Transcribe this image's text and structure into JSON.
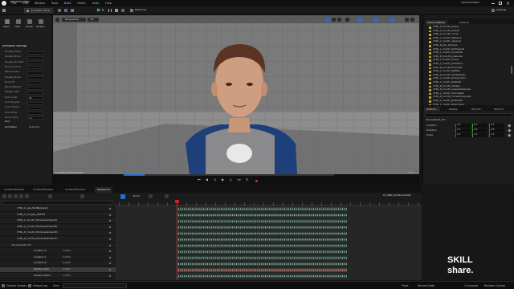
{
  "menu": {
    "items": [
      "File",
      "Edit",
      "Window",
      "Tools",
      "Build",
      "Select",
      "Actor",
      "Help"
    ],
    "level_tab": "TestPersonMap",
    "project_name": "MyFirstProject"
  },
  "toolbar": {
    "mode": "Animation Mode",
    "platforms": "Platforms",
    "settings": "Settings"
  },
  "viewport": {
    "perspective": "Perspective",
    "lit": "Lit",
    "camera_label": "LS_SNIP_Skill1animtest",
    "frame_readout": "0000"
  },
  "left_panel": {
    "mode_labels": [
      "Select",
      "Pose",
      "Pointer",
      "Snapper"
    ],
    "section_title": "Animation Settings",
    "rows": [
      "Display Mode",
      "Display Bone",
      "Display Number",
      "Bone Contour",
      "Blend Space",
      "Display Bone",
      "Bone Fit",
      "Blend Weight",
      "Display Size",
      "Axis Scale",
      "Cull Tangent",
      "Color Select",
      "Trail Mode",
      "Zoom Lens"
    ],
    "field_values": [
      "",
      "",
      "",
      "",
      "",
      "",
      "",
      "",
      "",
      "96",
      "",
      "",
      "",
      "1.0"
    ],
    "tool_section": "Tool",
    "selection_label": "Animation",
    "selection_value": "Selected"
  },
  "outliner": {
    "tabs": [
      "Scene Outliner",
      "Outliner"
    ],
    "items": [
      "CTRL_C_mouth_shape",
      "CTRL_C_mouth_stretch",
      "CTRL_C_mouth_corner",
      "CTRL_L_mouth_tightener",
      "CTRL_L_mouth_upperLip",
      "CTRL_R_lips_tensionL",
      "CTRL_L_mouth_lipsTowards",
      "CTRL_L_mouth_cornerPull",
      "CTRL_R_mouth_pressureL",
      "CTRL_L_mouth_funnel",
      "CTRL_L_mouth_pushPullU",
      "CTRL_R_mouth_thickness",
      "CTRL_L_mouth_lipBiteU",
      "CTRL_R_mouth_lipsTogether",
      "CTRL_L_mouth_stickyInnerU",
      "CTRL_L_mouth_lipsRollD",
      "CTRL_R_mouth_dimpler",
      "CTRL_R_mouth_lowerLipDepress",
      "CTRL_L_mouth_thicknessD",
      "CTRL_R_mouth_cornerSharpness",
      "CTRL_L_mouth_lipsPressU",
      "CTRL_L_mouth_stretchLips",
      "CTRL_C_mouth_towards",
      "CTRL_R_mouth_lipsPull"
    ]
  },
  "details": {
    "tabs": [
      "Anim D...",
      "Details",
      "World P...",
      "World S..."
    ],
    "selected": "ctrl_head_fk_ctrl",
    "rows": [
      {
        "label": "Location",
        "values": [
          "0.0",
          "0.0",
          "0.0"
        ]
      },
      {
        "label": "Rotation",
        "values": [
          "0.0",
          "0.0",
          "0.0"
        ]
      },
      {
        "label": "Scale",
        "values": [
          "1.0",
          "1.0",
          "1.0"
        ]
      }
    ]
  },
  "sequencer": {
    "tabs": [
      "Content Browser",
      "Content Browser",
      "Content Browser",
      "Sequencer"
    ],
    "fps": "30 fps",
    "sequence_name": "LS_SNIP_Skill1animtest",
    "current_frame": "0000",
    "tracks": [
      {
        "label": "CTRL_C_jaw_fwdBackward",
        "value": "",
        "indent": 6
      },
      {
        "label": "CTRL_C_tongue_RollTilt",
        "value": "",
        "indent": 6
      },
      {
        "label": "CTRL_L_mouth_thicknessInwardU",
        "value": "",
        "indent": 6
      },
      {
        "label": "CTRL_L_mouth_thicknessInwardD",
        "value": "",
        "indent": 6
      },
      {
        "label": "CTRL_R_mouth_thicknessInwardD",
        "value": "",
        "indent": 6
      },
      {
        "label": "CTRL_R_mouth_thicknessInwardU",
        "value": "",
        "indent": 6
      },
      {
        "label": "ctrl_head_fk_ctrl",
        "value": "",
        "indent": 4
      },
      {
        "label": "Location.X",
        "value": "0.0000",
        "indent": 12
      },
      {
        "label": "Location.Y",
        "value": "0.0000",
        "indent": 12
      },
      {
        "label": "Location.Z",
        "value": "0.0000",
        "indent": 12
      },
      {
        "label": "Rotation.Roll",
        "value": "0.0000",
        "indent": 12
      },
      {
        "label": "Rotation.Pitch",
        "value": "0.0000",
        "indent": 12
      }
    ]
  },
  "status": {
    "items": [
      "Content Drawer",
      "Output Log",
      "Cmd"
    ],
    "trace": "Trace",
    "derived_data": "Derived Data",
    "unsaved": "1 Unsaved",
    "revision": "Revision Control"
  },
  "watermark": "SKILL share.",
  "colors": {
    "accent_blue": "#1f6fd1",
    "play_green": "#3fbf3f",
    "key_orange": "#e08a1b",
    "folder_yellow": "#b9a33a"
  }
}
